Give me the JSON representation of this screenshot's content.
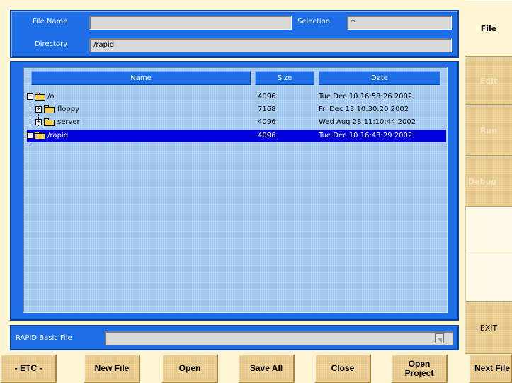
{
  "header": {
    "file_name_label": "File Name",
    "file_name_value": "",
    "selection_label": "Selection",
    "selection_value": "*",
    "directory_label": "Directory",
    "directory_value": "/rapid"
  },
  "browser": {
    "columns": [
      "Name",
      "Size",
      "Date"
    ],
    "rows": [
      {
        "name": "/o",
        "size": "4096",
        "date": "Tue Dec 10 16:53:26 2002",
        "expander": "−",
        "selected": false
      },
      {
        "name": "floppy",
        "size": "7168",
        "date": "Fri Dec 13 10:30:20 2002",
        "expander": "+",
        "selected": false
      },
      {
        "name": "server",
        "size": "4096",
        "date": "Wed Aug 28 11:10:44 2002",
        "expander": "+",
        "selected": false
      },
      {
        "name": "/rapid",
        "size": "4096",
        "date": "Tue Dec 10 16:43:29 2002",
        "expander": "+",
        "selected": true
      }
    ]
  },
  "file_type": {
    "label": "RAPID Basic File",
    "value": ""
  },
  "side_tabs": {
    "file": "File",
    "edit": "Edit",
    "run": "Run",
    "debug": "Debug",
    "exit": "EXIT"
  },
  "softkeys": {
    "etc": "- ETC -",
    "new_file": "New File",
    "open": "Open",
    "save_all": "Save All",
    "close": "Close",
    "open_project": "Open\nProject",
    "next_file": "Next File"
  },
  "colors": {
    "panel_blue": "#1e6ee8",
    "tree_bg": "#9dc6ee",
    "selection_blue": "#0000d8",
    "softkey_tan": "#e8c887"
  }
}
